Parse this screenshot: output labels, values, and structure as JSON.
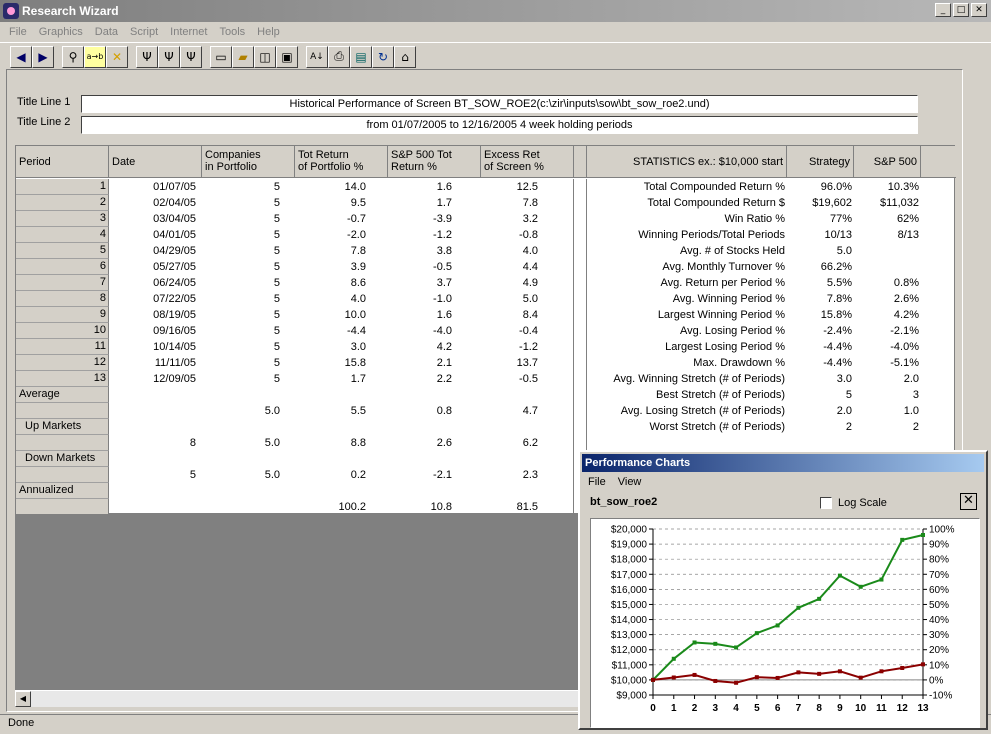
{
  "window": {
    "title": "Research Wizard"
  },
  "menu": [
    "File",
    "Graphics",
    "Data",
    "Script",
    "Internet",
    "Tools",
    "Help"
  ],
  "toolbar": {
    "icons": [
      "back-arrow-icon",
      "forward-arrow-icon",
      "binoculars-icon",
      "replace-icon",
      "cancel-icon",
      "filter-icon",
      "filter-ab-icon",
      "filter-down-icon",
      "new-doc-icon",
      "open-folder-icon",
      "preview-icon",
      "save-icon",
      "sort-icon",
      "print-icon",
      "trash-icon",
      "refresh-icon",
      "home-icon"
    ]
  },
  "titles": {
    "line1_label": "Title Line 1",
    "line1_value": "Historical Performance of Screen BT_SOW_ROE2(c:\\zir\\inputs\\sow\\bt_sow_roe2.und)",
    "line2_label": "Title Line 2",
    "line2_value": "from 01/07/2005 to 12/16/2005 4 week holding periods"
  },
  "table": {
    "headers": {
      "period": "Period",
      "date": "Date",
      "companies": [
        "Companies",
        "in Portfolio"
      ],
      "tot_return": [
        "Tot Return",
        "of Portfolio %"
      ],
      "sp500": [
        "S&P 500 Tot",
        "Return %"
      ],
      "excess": [
        "Excess Ret",
        "of Screen %"
      ]
    },
    "rows": [
      {
        "period": "1",
        "date": "01/07/05",
        "companies": "5",
        "tot": "14.0",
        "sp": "1.6",
        "excess": "12.5"
      },
      {
        "period": "2",
        "date": "02/04/05",
        "companies": "5",
        "tot": "9.5",
        "sp": "1.7",
        "excess": "7.8"
      },
      {
        "period": "3",
        "date": "03/04/05",
        "companies": "5",
        "tot": "-0.7",
        "sp": "-3.9",
        "excess": "3.2"
      },
      {
        "period": "4",
        "date": "04/01/05",
        "companies": "5",
        "tot": "-2.0",
        "sp": "-1.2",
        "excess": "-0.8"
      },
      {
        "period": "5",
        "date": "04/29/05",
        "companies": "5",
        "tot": "7.8",
        "sp": "3.8",
        "excess": "4.0"
      },
      {
        "period": "6",
        "date": "05/27/05",
        "companies": "5",
        "tot": "3.9",
        "sp": "-0.5",
        "excess": "4.4"
      },
      {
        "period": "7",
        "date": "06/24/05",
        "companies": "5",
        "tot": "8.6",
        "sp": "3.7",
        "excess": "4.9"
      },
      {
        "period": "8",
        "date": "07/22/05",
        "companies": "5",
        "tot": "4.0",
        "sp": "-1.0",
        "excess": "5.0"
      },
      {
        "period": "9",
        "date": "08/19/05",
        "companies": "5",
        "tot": "10.0",
        "sp": "1.6",
        "excess": "8.4"
      },
      {
        "period": "10",
        "date": "09/16/05",
        "companies": "5",
        "tot": "-4.4",
        "sp": "-4.0",
        "excess": "-0.4"
      },
      {
        "period": "11",
        "date": "10/14/05",
        "companies": "5",
        "tot": "3.0",
        "sp": "4.2",
        "excess": "-1.2"
      },
      {
        "period": "12",
        "date": "11/11/05",
        "companies": "5",
        "tot": "15.8",
        "sp": "2.1",
        "excess": "13.7"
      },
      {
        "period": "13",
        "date": "12/09/05",
        "companies": "5",
        "tot": "1.7",
        "sp": "2.2",
        "excess": "-0.5"
      }
    ],
    "summary": [
      {
        "label": "Average",
        "date": "",
        "companies": "",
        "tot": "",
        "sp": "",
        "excess": ""
      },
      {
        "label": "",
        "date": "",
        "companies": "5.0",
        "tot": "5.5",
        "sp": "0.8",
        "excess": "4.7"
      },
      {
        "label": "Up Markets",
        "date": "",
        "companies": "",
        "tot": "",
        "sp": "",
        "excess": ""
      },
      {
        "label": "",
        "date": "8",
        "companies": "5.0",
        "tot": "8.8",
        "sp": "2.6",
        "excess": "6.2"
      },
      {
        "label": "Down Markets",
        "date": "",
        "companies": "",
        "tot": "",
        "sp": "",
        "excess": ""
      },
      {
        "label": "",
        "date": "5",
        "companies": "5.0",
        "tot": "0.2",
        "sp": "-2.1",
        "excess": "2.3"
      },
      {
        "label": "Annualized",
        "date": "",
        "companies": "",
        "tot": "",
        "sp": "",
        "excess": ""
      },
      {
        "label": "",
        "date": "",
        "companies": "",
        "tot": "100.2",
        "sp": "10.8",
        "excess": "81.5"
      }
    ]
  },
  "stats": {
    "headers": {
      "label": "STATISTICS  ex.: $10,000 start",
      "strategy": "Strategy",
      "sp500": "S&P 500"
    },
    "rows": [
      {
        "label": "Total Compounded Return %",
        "strategy": "96.0%",
        "sp": "10.3%"
      },
      {
        "label": "Total Compounded Return $",
        "strategy": "$19,602",
        "sp": "$11,032"
      },
      {
        "label": "Win Ratio %",
        "strategy": "77%",
        "sp": "62%"
      },
      {
        "label": "Winning Periods/Total Periods",
        "strategy": "10/13",
        "sp": "8/13"
      },
      {
        "label": "Avg. # of Stocks Held",
        "strategy": "5.0",
        "sp": ""
      },
      {
        "label": "Avg. Monthly Turnover %",
        "strategy": "66.2%",
        "sp": ""
      },
      {
        "label": "Avg. Return per Period %",
        "strategy": "5.5%",
        "sp": "0.8%"
      },
      {
        "label": "Avg. Winning Period %",
        "strategy": "7.8%",
        "sp": "2.6%"
      },
      {
        "label": "Largest Winning Period %",
        "strategy": "15.8%",
        "sp": "4.2%"
      },
      {
        "label": "Avg. Losing Period %",
        "strategy": "-2.4%",
        "sp": "-2.1%"
      },
      {
        "label": "Largest Losing Period %",
        "strategy": "-4.4%",
        "sp": "-4.0%"
      },
      {
        "label": "Max. Drawdown %",
        "strategy": "-4.4%",
        "sp": "-5.1%"
      },
      {
        "label": "Avg. Winning Stretch (# of Periods)",
        "strategy": "3.0",
        "sp": "2.0"
      },
      {
        "label": "Best Stretch (# of Periods)",
        "strategy": "5",
        "sp": "3"
      },
      {
        "label": "Avg. Losing Stretch (# of Periods)",
        "strategy": "2.0",
        "sp": "1.0"
      },
      {
        "label": "Worst Stretch (# of Periods)",
        "strategy": "2",
        "sp": "2"
      }
    ]
  },
  "status": {
    "text": "Done"
  },
  "perf": {
    "title": "Performance Charts",
    "menu": [
      "File",
      "View"
    ],
    "name": "bt_sow_roe2",
    "log_label": "Log Scale",
    "log_checked": false
  },
  "chart_data": {
    "type": "line",
    "title": "",
    "x": [
      0,
      1,
      2,
      3,
      4,
      5,
      6,
      7,
      8,
      9,
      10,
      11,
      12,
      13
    ],
    "ylim": [
      9000,
      20000
    ],
    "yticks": [
      "$9,000",
      "$10,000",
      "$11,000",
      "$12,000",
      "$13,000",
      "$14,000",
      "$15,000",
      "$16,000",
      "$17,000",
      "$18,000",
      "$19,000",
      "$20,000"
    ],
    "y2lim": [
      -10,
      100
    ],
    "y2ticks": [
      "-10%",
      "0%",
      "10%",
      "20%",
      "30%",
      "40%",
      "50%",
      "60%",
      "70%",
      "80%",
      "90%",
      "100%"
    ],
    "grid": true,
    "series": [
      {
        "color": "#1a8a1a",
        "values": [
          10000,
          11400,
          12480,
          12390,
          12150,
          13100,
          13610,
          14780,
          15370,
          16910,
          16170,
          16650,
          19280,
          19602
        ]
      },
      {
        "color": "#8b0000",
        "values": [
          10000,
          10160,
          10330,
          9930,
          9810,
          10180,
          10130,
          10500,
          10400,
          10570,
          10150,
          10570,
          10790,
          11032
        ]
      }
    ]
  }
}
